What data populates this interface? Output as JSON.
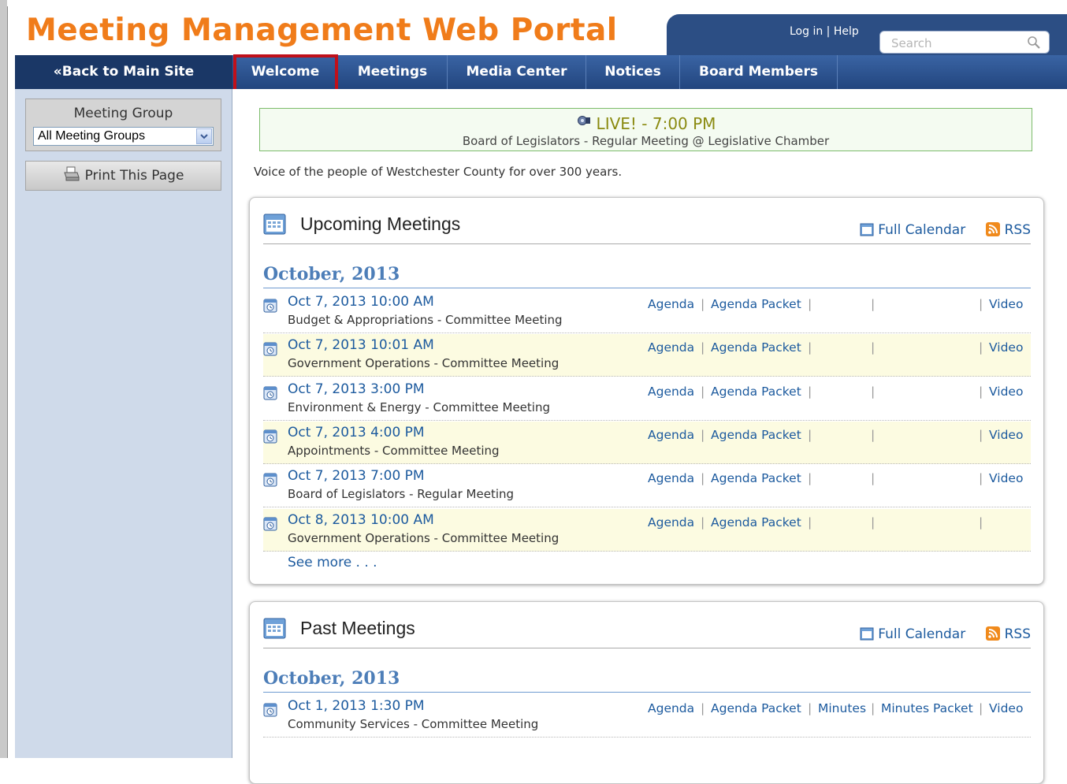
{
  "header": {
    "site_title": "Meeting Management Web Portal",
    "login_label": "Log in",
    "help_label": "Help",
    "search_placeholder": "Search"
  },
  "nav": {
    "back_label": "«Back to Main Site",
    "tabs": [
      {
        "label": "Welcome",
        "active": true
      },
      {
        "label": "Meetings"
      },
      {
        "label": "Media Center"
      },
      {
        "label": "Notices"
      },
      {
        "label": "Board Members"
      }
    ]
  },
  "sidebar": {
    "meeting_group_label": "Meeting Group",
    "meeting_group_value": "All Meeting Groups",
    "print_label": "Print This Page"
  },
  "live": {
    "title": "LIVE! - 7:00 PM",
    "subtitle": "Board of Legislators - Regular Meeting @ Legislative Chamber"
  },
  "tagline": "Voice of the people of Westchester County for over 300 years.",
  "upcoming": {
    "title": "Upcoming Meetings",
    "full_calendar": "Full Calendar",
    "rss": "RSS",
    "month": "October, 2013",
    "see_more": "See more . . .",
    "rows": [
      {
        "date": "Oct 7, 2013 10:00 AM",
        "name": "Budget & Appropriations - Committee Meeting",
        "agenda": "Agenda",
        "packet": "Agenda Packet",
        "video": "Video"
      },
      {
        "date": "Oct 7, 2013 10:01 AM",
        "name": "Government Operations - Committee Meeting",
        "agenda": "Agenda",
        "packet": "Agenda Packet",
        "video": "Video"
      },
      {
        "date": "Oct 7, 2013 3:00 PM",
        "name": "Environment & Energy - Committee Meeting",
        "agenda": "Agenda",
        "packet": "Agenda Packet",
        "video": "Video"
      },
      {
        "date": "Oct 7, 2013 4:00 PM",
        "name": "Appointments - Committee Meeting",
        "agenda": "Agenda",
        "packet": "Agenda Packet",
        "video": "Video"
      },
      {
        "date": "Oct 7, 2013 7:00 PM",
        "name": "Board of Legislators - Regular Meeting",
        "agenda": "Agenda",
        "packet": "Agenda Packet",
        "video": "Video"
      },
      {
        "date": "Oct 8, 2013 10:00 AM",
        "name": "Government Operations - Committee Meeting",
        "agenda": "Agenda",
        "packet": "Agenda Packet",
        "video": ""
      }
    ]
  },
  "past": {
    "title": "Past Meetings",
    "full_calendar": "Full Calendar",
    "rss": "RSS",
    "month": "October, 2013",
    "rows": [
      {
        "date": "Oct 1, 2013 1:30 PM",
        "name": "Community Services - Committee Meeting",
        "agenda": "Agenda",
        "packet": "Agenda Packet",
        "minutes": "Minutes",
        "minutes_packet": "Minutes Packet",
        "video": "Video"
      }
    ]
  },
  "colors": {
    "title_orange": "#f07c1a",
    "nav_blue": "#2c4e84",
    "link_blue": "#1c5a9e",
    "month_blue": "#4d7eb8",
    "alt_row": "#fcfbe1",
    "highlight_red": "#c0101a"
  }
}
